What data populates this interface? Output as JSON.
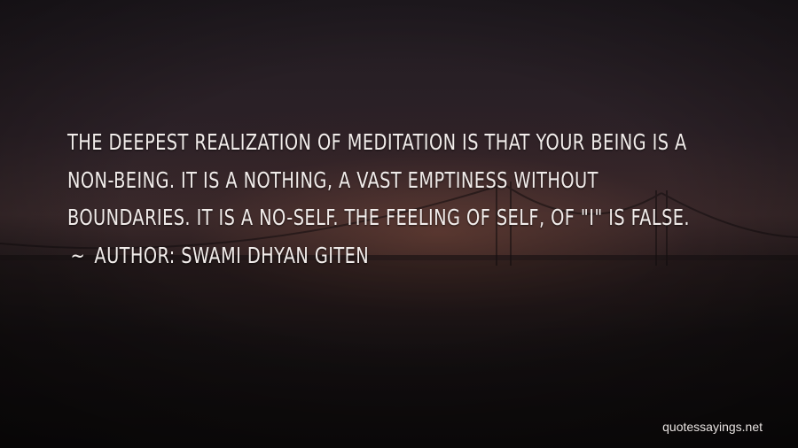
{
  "quote": {
    "lines": [
      "THE DEEPEST REALIZATION OF MEDITATION IS THAT YOUR BEING IS A",
      "NON-BEING. IT IS A NOTHING, A VAST EMPTINESS WITHOUT",
      "BOUNDARIES. IT IS A NO-SELF. THE FEELING OF SELF, OF \"I\" IS FALSE."
    ],
    "author_prefix": "~",
    "author": "AUTHOR: SWAMI DHYAN GITEN"
  },
  "watermark": "quotessayings.net",
  "colors": {
    "text": "#f1ecea",
    "background_dark": "#1b1517",
    "horizon_glow": "#784637"
  }
}
